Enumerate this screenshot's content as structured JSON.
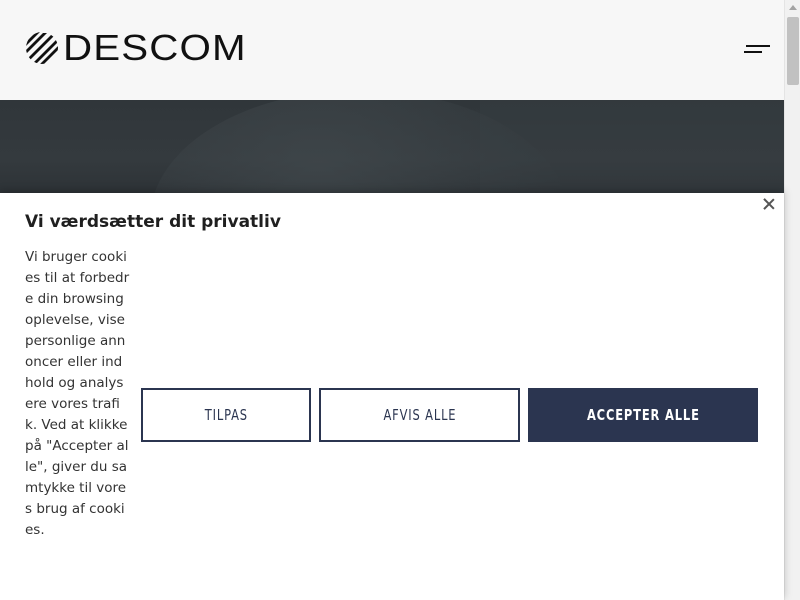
{
  "header": {
    "logo_text": "DESCOM",
    "logo_icon": "descom-logo-mark",
    "menu_icon": "hamburger-menu-icon"
  },
  "consent": {
    "title": "Vi værdsætter dit privatliv",
    "body": "Vi bruger cookies til at forbedre din browsingoplevelse, vise personlige annoncer eller indhold og analysere vores trafik. Ved at klikke på \"Accepter alle\", giver du samtykke til vores brug af cookies.",
    "close_icon": "close-icon",
    "buttons": {
      "customize": "TILPAS",
      "reject": "AFVIS ALLE",
      "accept": "ACCEPTER ALLE"
    }
  },
  "colors": {
    "brand_navy": "#2b3550",
    "header_bg": "#f7f7f7",
    "hero_bg": "#32383c"
  }
}
